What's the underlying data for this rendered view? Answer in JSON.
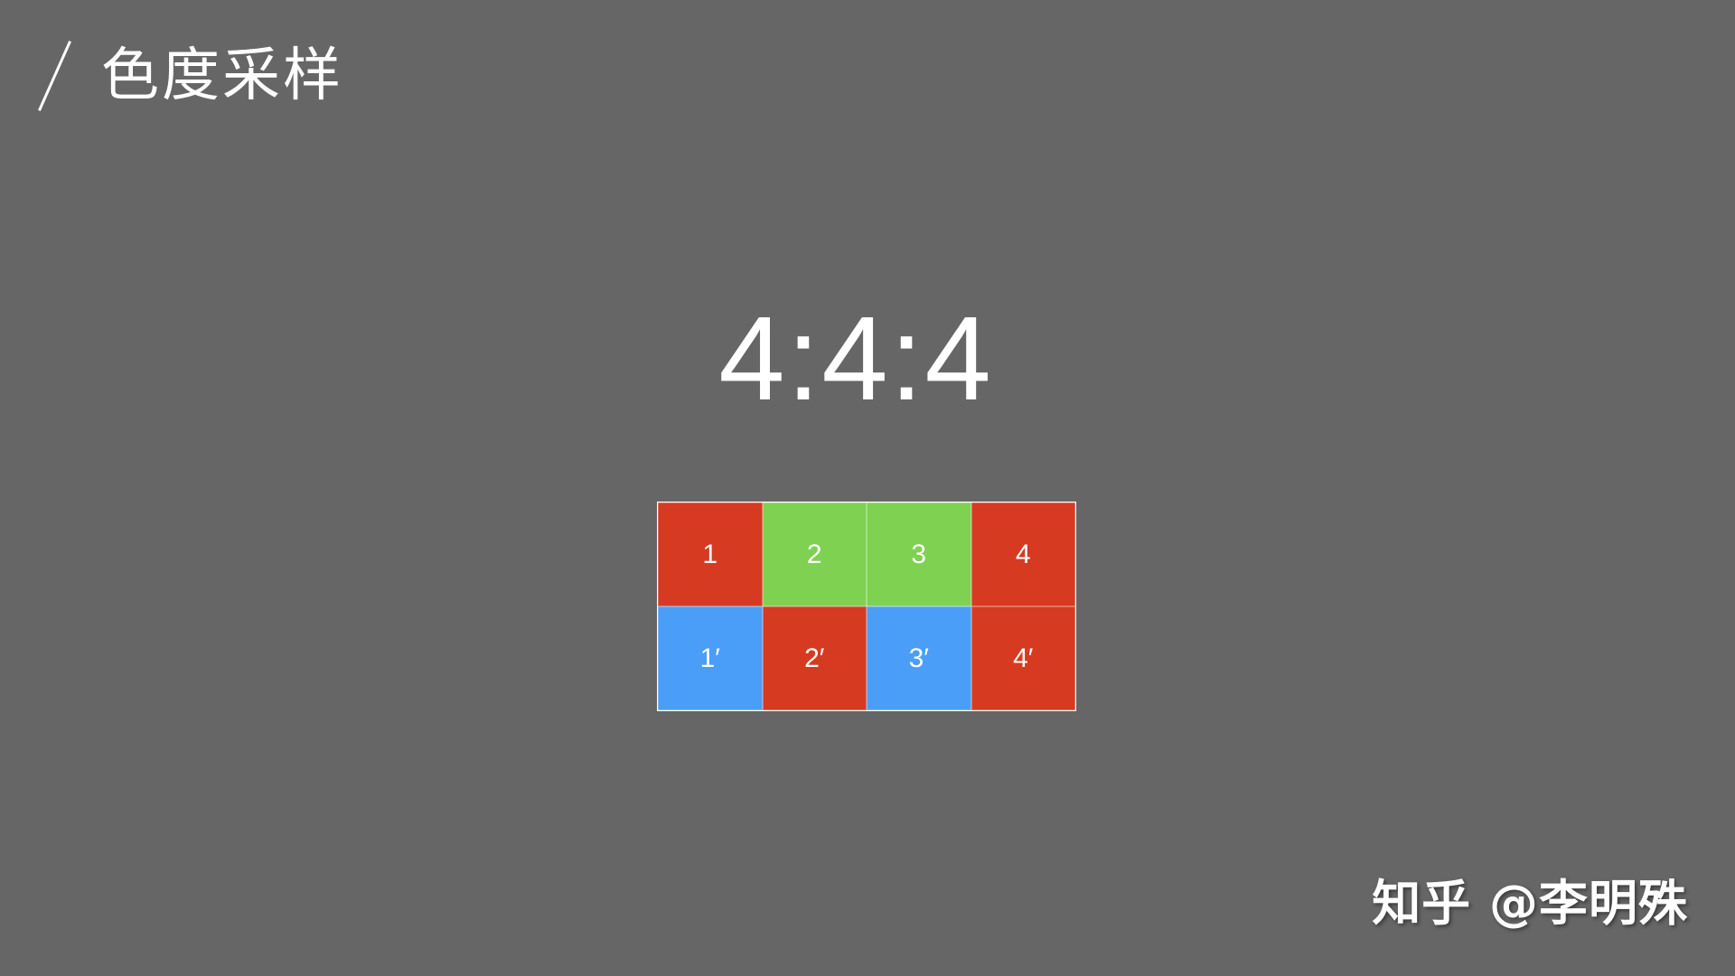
{
  "header": {
    "title": "色度采样"
  },
  "diagram": {
    "ratio_label": "4:4:4",
    "rows": [
      [
        {
          "label": "1",
          "color": "#d63b22"
        },
        {
          "label": "2",
          "color": "#7fd152"
        },
        {
          "label": "3",
          "color": "#7fd152"
        },
        {
          "label": "4",
          "color": "#d63b22"
        }
      ],
      [
        {
          "label": "1′",
          "color": "#4a9ef7"
        },
        {
          "label": "2′",
          "color": "#d63b22"
        },
        {
          "label": "3′",
          "color": "#4a9ef7"
        },
        {
          "label": "4′",
          "color": "#d63b22"
        }
      ]
    ]
  },
  "watermark": {
    "text": "知乎 @李明殊"
  }
}
